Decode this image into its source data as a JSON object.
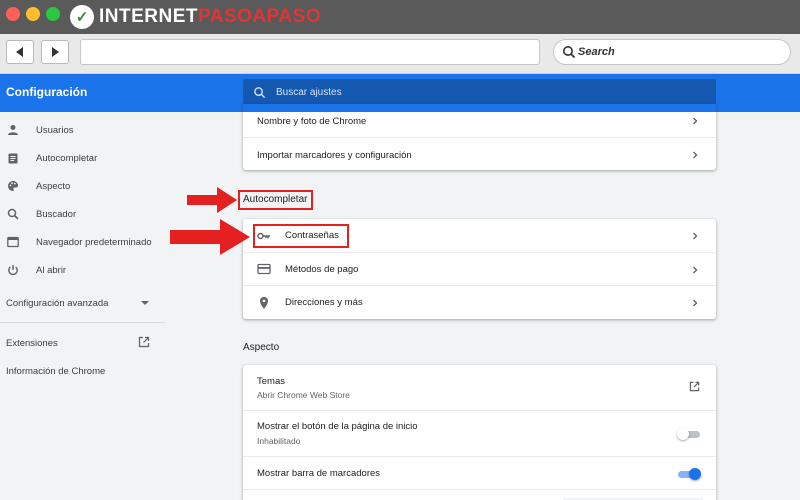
{
  "window": {
    "logo_prefix": "INTERNET",
    "logo_accent": "PASOAPASO",
    "logo_mark": "✓"
  },
  "toolbar": {
    "search_label": "Search",
    "url_value": ""
  },
  "header": {
    "title": "Configuración",
    "search_placeholder": "Buscar ajustes"
  },
  "sidebar": {
    "items": [
      {
        "label": "Usuarios",
        "icon": "person-icon"
      },
      {
        "label": "Autocompletar",
        "icon": "clipboard-icon"
      },
      {
        "label": "Aspecto",
        "icon": "palette-icon"
      },
      {
        "label": "Buscador",
        "icon": "search-icon"
      },
      {
        "label": "Navegador predeterminado",
        "icon": "browser-icon"
      },
      {
        "label": "Al abrir",
        "icon": "power-icon"
      }
    ],
    "advanced_label": "Configuración avanzada",
    "extensions_label": "Extensiones",
    "chrome_info_label": "Información de Chrome"
  },
  "main": {
    "users_card": {
      "rows": [
        {
          "label": "Nombre y foto de Chrome"
        },
        {
          "label": "Importar marcadores y configuración"
        }
      ]
    },
    "autofill": {
      "title": "Autocompletar",
      "rows": [
        {
          "label": "Contraseñas",
          "icon": "key-icon"
        },
        {
          "label": "Métodos de pago",
          "icon": "credit-card-icon"
        },
        {
          "label": "Direcciones y más",
          "icon": "location-pin-icon"
        }
      ]
    },
    "appearance": {
      "title": "Aspecto",
      "themes_label": "Temas",
      "themes_sub": "Abrir Chrome Web Store",
      "home_button_label": "Mostrar el botón de la página de inicio",
      "home_button_sub": "Inhabilitado",
      "home_button_enabled": false,
      "bookmarks_bar_label": "Mostrar barra de marcadores",
      "bookmarks_bar_enabled": true
    }
  },
  "colors": {
    "accent": "#1a73e8",
    "annotation": "#e52020"
  }
}
